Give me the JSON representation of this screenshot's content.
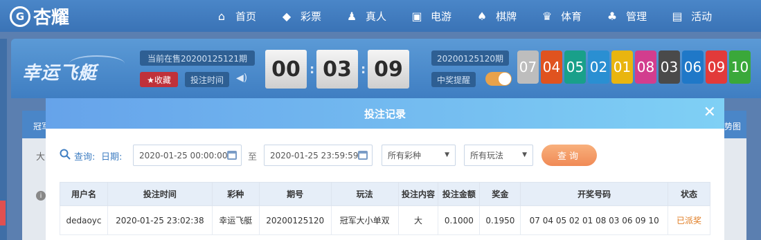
{
  "nav": {
    "logo": "杏耀",
    "logo_mark": "G",
    "items": [
      {
        "label": "首页",
        "icon": "home-icon",
        "glyph": "⌂"
      },
      {
        "label": "彩票",
        "icon": "ticket-icon",
        "glyph": "◆"
      },
      {
        "label": "真人",
        "icon": "user-icon",
        "glyph": "♟"
      },
      {
        "label": "电游",
        "icon": "arcade-icon",
        "glyph": "▣"
      },
      {
        "label": "棋牌",
        "icon": "cards-icon",
        "glyph": "♠"
      },
      {
        "label": "体育",
        "icon": "trophy-icon",
        "glyph": "♛"
      },
      {
        "label": "管理",
        "icon": "users-icon",
        "glyph": "♣"
      },
      {
        "label": "活动",
        "icon": "gift-icon",
        "glyph": "▤"
      }
    ]
  },
  "game": {
    "name": "幸运飞艇",
    "current_period": "当前在售20200125121期",
    "favorite": "★收藏",
    "bet_time": "投注时间",
    "countdown": [
      "00",
      "03",
      "09"
    ],
    "last_period": "20200125120期",
    "remind": "中奖提醒",
    "balls": [
      "07",
      "04",
      "05",
      "02",
      "01",
      "08",
      "03",
      "06",
      "09",
      "10"
    ],
    "ball_colors": [
      "#bdbdbd",
      "#e0531f",
      "#19a08a",
      "#2a8fd2",
      "#e9b50f",
      "#d23d8e",
      "#4a4a4a",
      "#1f78c8",
      "#e23a3a",
      "#3aa83a"
    ]
  },
  "page": {
    "tab_left": "冠军",
    "tab_right": "趋势图",
    "row_label": "大"
  },
  "modal": {
    "title": "投注记录",
    "query_label": "查询:",
    "date_label": "日期:",
    "date_from": "2020-01-25 00:00:00",
    "to_label": "至",
    "date_to": "2020-01-25 23:59:59",
    "lottery_select": "所有彩种",
    "play_select": "所有玩法",
    "query_button": "查询",
    "table": {
      "headers": [
        "用户名",
        "投注时间",
        "彩种",
        "期号",
        "玩法",
        "投注内容",
        "投注金额",
        "奖金",
        "开奖号码",
        "状态"
      ],
      "rows": [
        [
          "dedaoyc",
          "2020-01-25 23:02:38",
          "幸运飞艇",
          "20200125120",
          "冠军大小单双",
          "大",
          "0.1000",
          "0.1950",
          "07 04 05 02 01 08 03 06 09 10",
          "已派奖"
        ]
      ]
    }
  }
}
